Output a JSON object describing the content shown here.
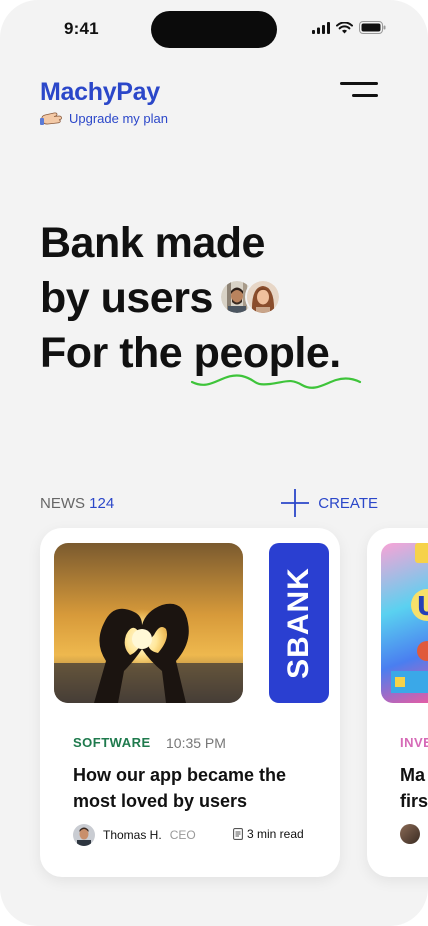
{
  "status_bar": {
    "time": "9:41"
  },
  "header": {
    "brand": "MachyPay",
    "upgrade_label": "Upgrade my plan"
  },
  "hero": {
    "line1": "Bank made",
    "line2": "by users",
    "line3_prefix": "For the",
    "line3_highlight": "people."
  },
  "news": {
    "label": "NEWS",
    "count": "124",
    "create_label": "CREATE"
  },
  "cards": [
    {
      "category": "SOFTWARE",
      "time": "10:35 PM",
      "title": "How our app became the most loved by users",
      "author": "Thomas H.",
      "role": "CEO",
      "read_time": "3 min read",
      "side_image_text": "SBANK",
      "colors": {
        "category": "#1f7a4d",
        "side_image_bg": "#2a3fd1"
      }
    },
    {
      "category": "INVE",
      "title_line1": "Ma",
      "title_line2": "firs",
      "colors": {
        "category": "#d66ab7"
      }
    }
  ],
  "colors": {
    "accent": "#2b47c9",
    "background": "#f3f3f3",
    "squiggle": "#3ec43a"
  },
  "icons": [
    "signal-icon",
    "wifi-icon",
    "battery-icon",
    "menu-icon",
    "hand-emoji-icon",
    "plus-icon",
    "document-icon"
  ]
}
